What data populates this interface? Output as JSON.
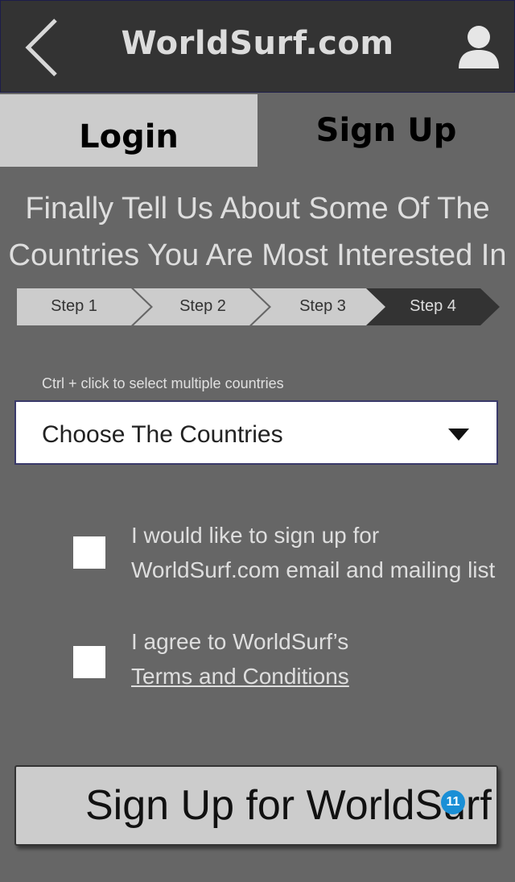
{
  "header": {
    "title": "WorldSurf.com",
    "back_icon": "chevron-left-icon",
    "profile_icon": "user-icon"
  },
  "tabs": [
    {
      "label": "Login",
      "active": false
    },
    {
      "label": "Sign Up",
      "active": true
    }
  ],
  "heading": {
    "line1": "Finally Tell Us About Some Of The",
    "line2": "Countries You Are Most Interested In"
  },
  "steps": [
    {
      "label": "Step 1",
      "active": false
    },
    {
      "label": "Step 2",
      "active": false
    },
    {
      "label": "Step 3",
      "active": false
    },
    {
      "label": "Step 4",
      "active": true
    }
  ],
  "countries": {
    "hint": "Ctrl + click to select multiple countries",
    "select_label": "Choose The Countries",
    "caret_icon": "caret-down-icon"
  },
  "checkboxes": [
    {
      "line1": "I would like to sign up for",
      "line2": "WorldSurf.com email and mailing list",
      "checked": false
    },
    {
      "line1": "I agree to WorldSurf’s",
      "link": "Terms and Conditions",
      "checked": false
    }
  ],
  "submit": {
    "label": "Sign Up for WorldSurf",
    "badge": "11"
  },
  "colors": {
    "background": "#666666",
    "header": "#333333",
    "tab_inactive": "#cccccc",
    "step_inactive": "#cccccc",
    "step_active": "#333333",
    "badge": "#1a8fd6"
  }
}
